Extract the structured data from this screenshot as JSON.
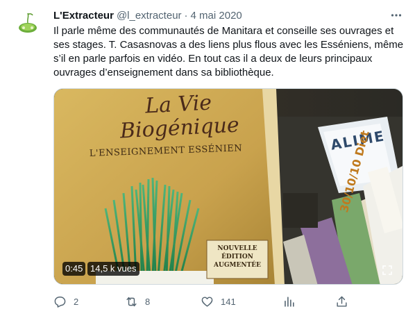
{
  "tweet": {
    "author_name": "L'Extracteur",
    "author_handle": "@l_extracteur",
    "separator": "·",
    "date": "4 mai 2020",
    "text": "Il parle même des communautés de Manitara et conseille ses ouvrages et ses stages. T. Casasnovas a des liens plus flous avec les Esséniens, même s’il en parle parfois en vidéo. En tout cas il a deux de leurs principaux ouvrages d’enseignement dans sa bibliothèque."
  },
  "media": {
    "book_title_line1": "La Vie",
    "book_title_line2": "Biogénique",
    "book_subtitle": "L'ENSEIGNEMENT ESSÉNIEN",
    "book_stamp_line1": "NOUVELLE",
    "book_stamp_line2": "ÉDITION",
    "book_stamp_line3": "AUGMENTÉE",
    "spine_text": "30/10/10 Diet",
    "book_top_text": "ALIME",
    "duration": "0:45",
    "views": "14,5 k vues"
  },
  "actions": {
    "replies": "2",
    "retweets": "8",
    "likes": "141"
  },
  "colors": {
    "text": "#0f1419",
    "secondary": "#536471",
    "border": "#cfd9de"
  }
}
